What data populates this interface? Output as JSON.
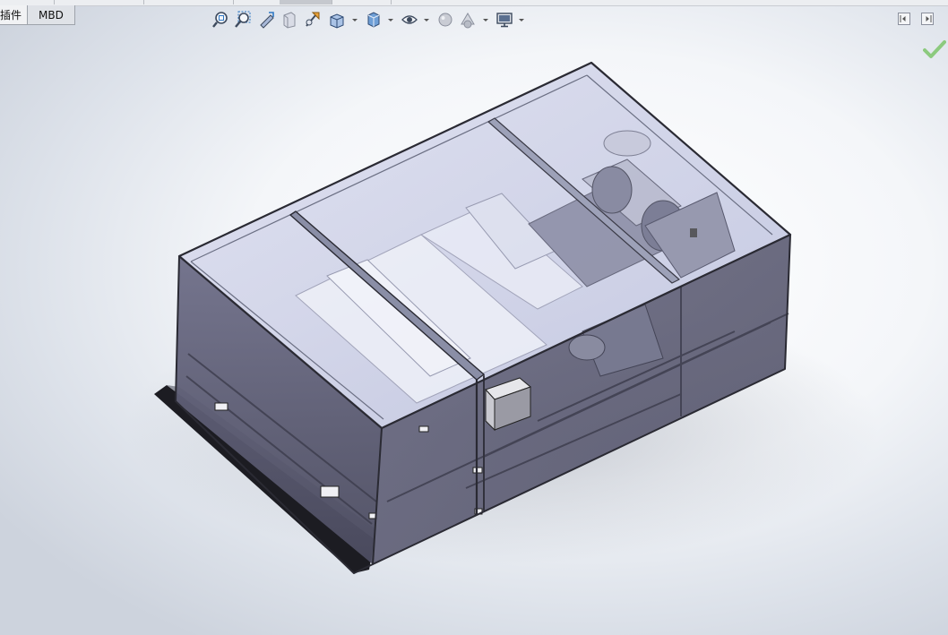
{
  "tabs": [
    {
      "label": "插件"
    },
    {
      "label": "MBD"
    }
  ],
  "heads_up_toolbar": [
    "zoom-to-fit-icon",
    "zoom-to-area-icon",
    "previous-view-icon",
    "section-view-icon",
    "dynamic-annotation-icon",
    "view-orientation-icon",
    "display-style-icon",
    "hide-show-items-icon",
    "edit-appearance-icon",
    "apply-scene-icon",
    "view-settings-icon"
  ],
  "colors": {
    "accent_check": "#7dc46a",
    "glass_top": "#c9cde4",
    "glass_side_dark": "#5a5a72",
    "frame_line": "#2a2a33"
  }
}
